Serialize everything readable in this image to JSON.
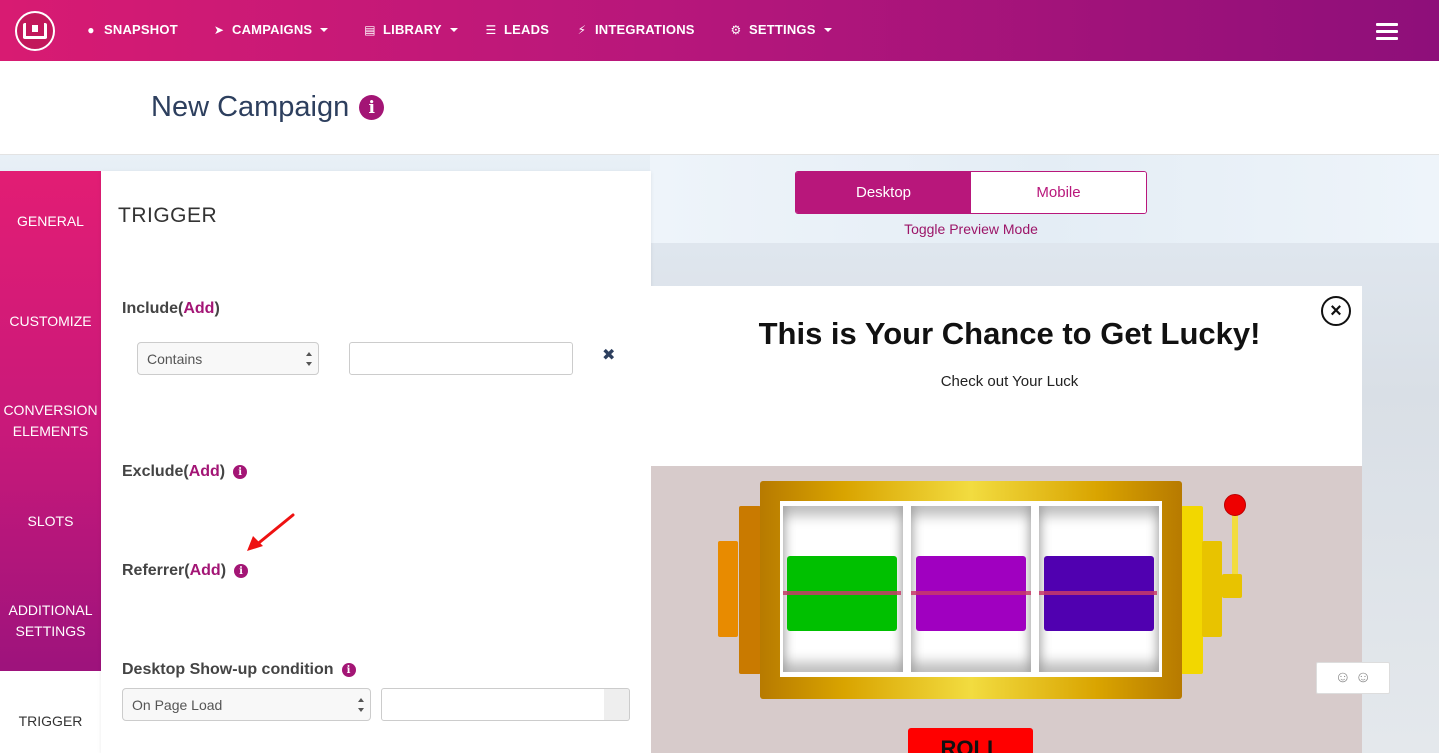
{
  "nav": {
    "items": [
      {
        "label": "SNAPSHOT",
        "icon": "dashboard-icon"
      },
      {
        "label": "CAMPAIGNS",
        "icon": "paper-plane-icon"
      },
      {
        "label": "LIBRARY",
        "icon": "library-icon"
      },
      {
        "label": "LEADS",
        "icon": "list-icon"
      },
      {
        "label": "INTEGRATIONS",
        "icon": "plug-icon"
      },
      {
        "label": "SETTINGS",
        "icon": "gears-icon"
      }
    ]
  },
  "header": {
    "title": "New Campaign"
  },
  "sidebar": {
    "tabs": [
      {
        "label": "GENERAL"
      },
      {
        "label": "CUSTOMIZE"
      },
      {
        "label": "CONVERSION ELEMENTS"
      },
      {
        "label": "SLOTS"
      },
      {
        "label": "ADDITIONAL SETTINGS"
      },
      {
        "label": "TRIGGER",
        "active": true
      }
    ]
  },
  "trigger": {
    "title": "TRIGGER",
    "include": {
      "label": "Include",
      "add": "Add",
      "open": "(",
      "close": ")",
      "rule_select": "Contains",
      "rule_value": ""
    },
    "exclude": {
      "label": "Exclude",
      "add": "Add",
      "open": "(",
      "close": ")"
    },
    "referrer": {
      "label": "Referrer",
      "add": "Add",
      "open": "(",
      "close": ")"
    },
    "desktop_condition": {
      "label": "Desktop Show-up condition",
      "select": "On Page Load",
      "value": ""
    }
  },
  "preview": {
    "toggle": {
      "desktop": "Desktop",
      "mobile": "Mobile",
      "selected": "Desktop"
    },
    "caption": "Toggle Preview Mode",
    "popup": {
      "title": "This is Your Chance to Get Lucky!",
      "subtitle": "Check out Your Luck",
      "roll_button": "ROLL",
      "reel_colors": [
        "#00c000",
        "#a000c0",
        "#5000b0"
      ]
    }
  },
  "colors": {
    "brand": "#b8177b",
    "accent": "#a31575"
  }
}
